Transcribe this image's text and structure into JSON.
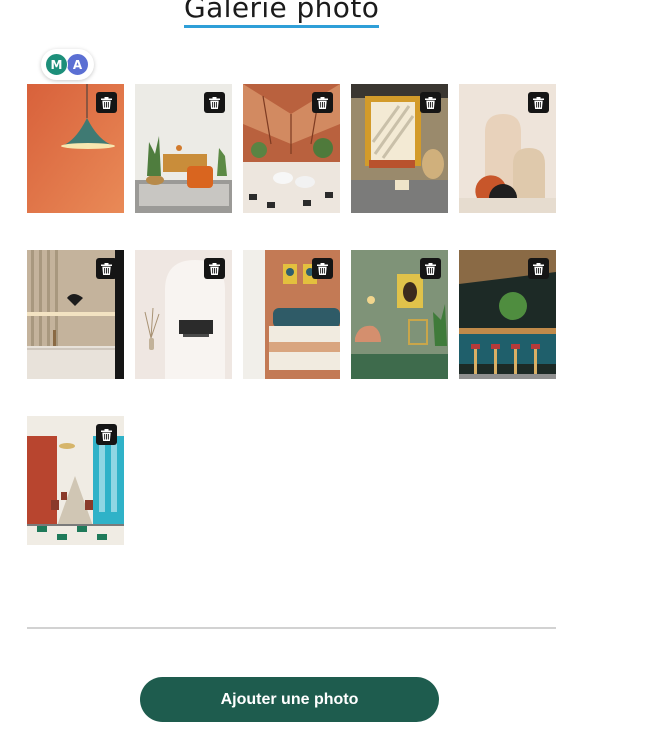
{
  "header": {
    "title": "Galerie photo"
  },
  "collaborators": [
    {
      "initial": "M",
      "color": "#1d8f7a"
    },
    {
      "initial": "A",
      "color": "#5b6fd3"
    }
  ],
  "gallery": {
    "photos": [
      {
        "subject": "orange wall with teal pendant lamp",
        "delete_icon": "trash-icon"
      },
      {
        "subject": "living room with orange armchair and plants",
        "delete_icon": "trash-icon"
      },
      {
        "subject": "restaurant with glass roof and wooden beams",
        "delete_icon": "trash-icon"
      },
      {
        "subject": "yellow frame with rattan hanging chair",
        "delete_icon": "trash-icon"
      },
      {
        "subject": "beige arches with terracotta and black shapes",
        "delete_icon": "trash-icon"
      },
      {
        "subject": "wood slat wall with black wall lamp",
        "delete_icon": "trash-icon"
      },
      {
        "subject": "white arch doorway with sofa and vase",
        "delete_icon": "trash-icon"
      },
      {
        "subject": "bedroom with teal headboard and portraits",
        "delete_icon": "trash-icon"
      },
      {
        "subject": "green room with portrait and pink armchair",
        "delete_icon": "trash-icon"
      },
      {
        "subject": "teal bar counter with red stools",
        "delete_icon": "trash-icon"
      },
      {
        "subject": "long red dining hall with checkered floor",
        "delete_icon": "trash-icon"
      }
    ]
  },
  "actions": {
    "add_photo_label": "Ajouter une photo"
  },
  "colors": {
    "accent_underline": "#2f9fd8",
    "primary_button": "#1e5c4e"
  }
}
